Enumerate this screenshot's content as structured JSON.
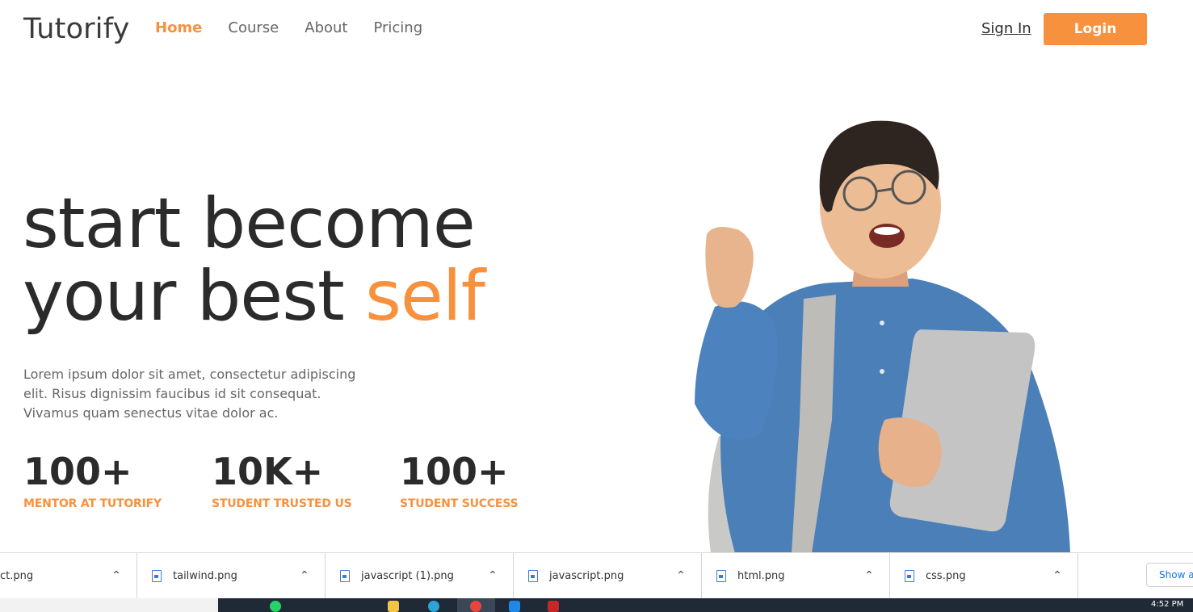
{
  "nav": {
    "logo": "Tutorify",
    "links": [
      "Home",
      "Course",
      "About",
      "Pricing"
    ],
    "active_link": "Home",
    "sign_in": "Sign In",
    "login": "Login"
  },
  "hero": {
    "headline_line1": "start become",
    "headline_line2_prefix": "your best ",
    "headline_line2_accent": "self",
    "description": "Lorem ipsum dolor sit amet, consectetur adipiscing elit. Risus dignissim faucibus id sit consequat. Vivamus quam senectus vitae dolor ac.",
    "stats": [
      {
        "value": "100+",
        "label": "MENTOR AT TUTORIFY"
      },
      {
        "value": "10K+",
        "label": "STUDENT TRUSTED US"
      },
      {
        "value": "100+",
        "label": "STUDENT SUCCESS"
      }
    ]
  },
  "downloads": {
    "items": [
      "ct.png",
      "tailwind.png",
      "javascript (1).png",
      "javascript.png",
      "html.png",
      "css.png"
    ],
    "show_all": "Show all"
  },
  "taskbar": {
    "time": "4:52 PM"
  },
  "colors": {
    "accent": "#f7913d",
    "text_dark": "#2b2b2b",
    "text_muted": "#666666",
    "taskbar": "#1f2a36"
  }
}
